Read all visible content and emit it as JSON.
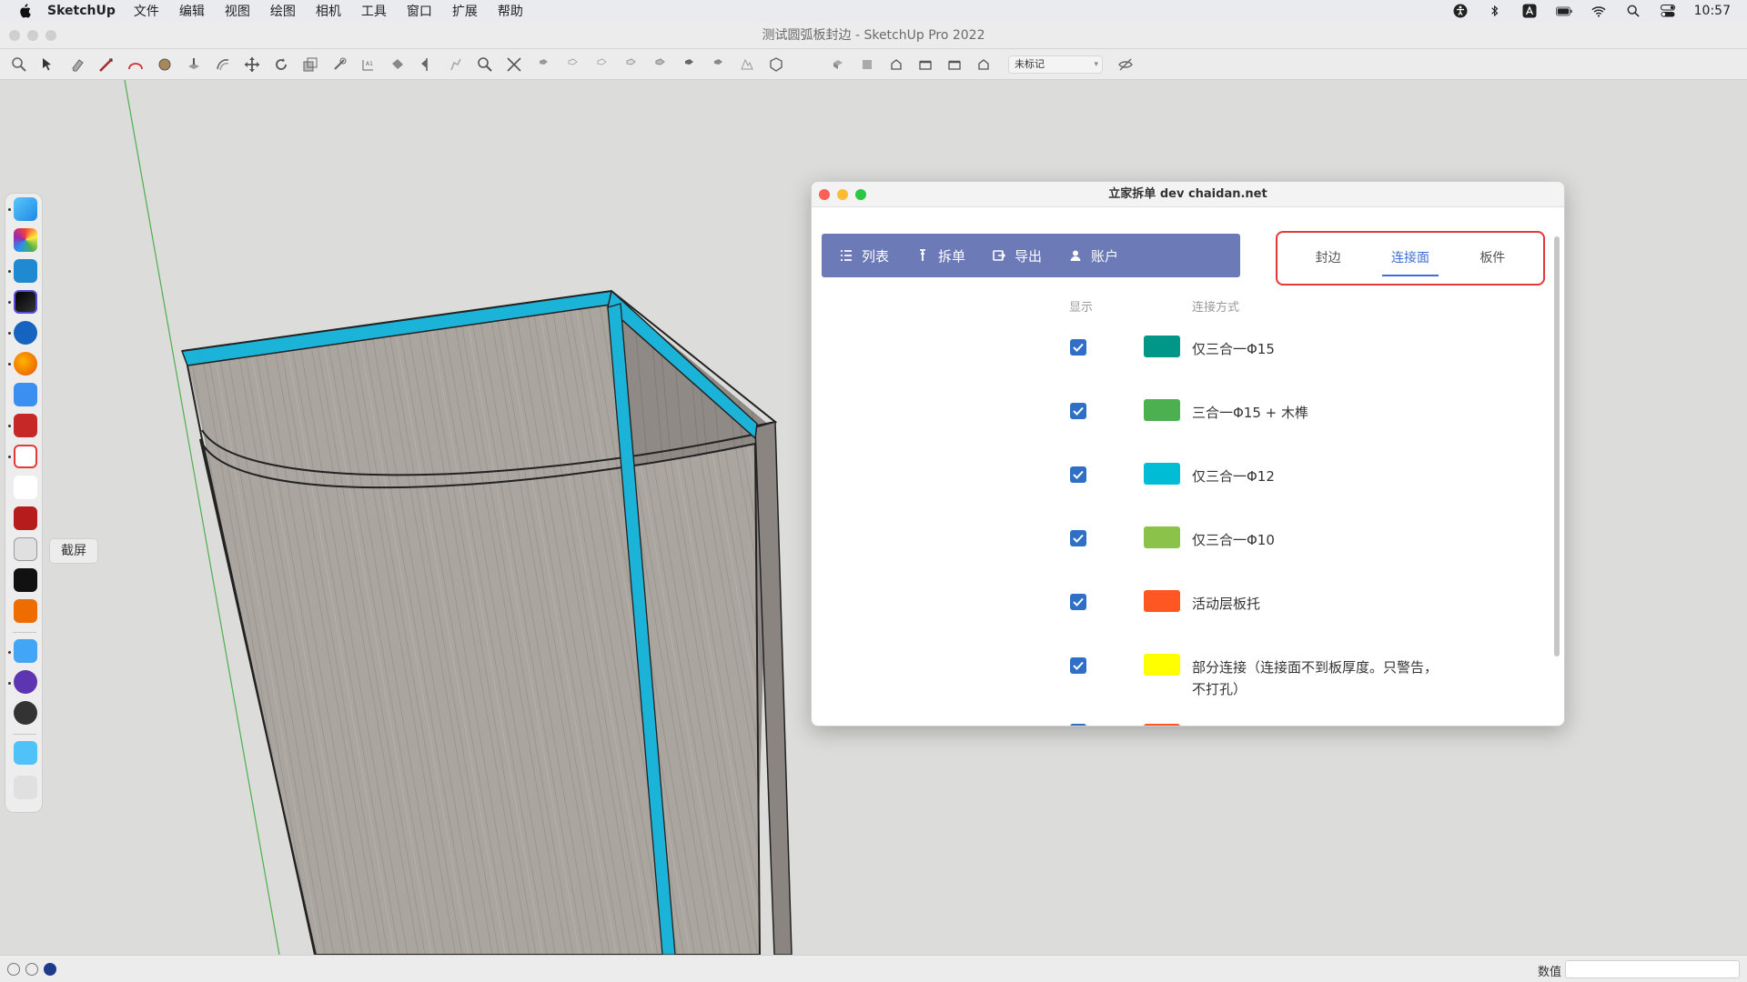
{
  "menubar": {
    "app_name": "SketchUp",
    "items": [
      "文件",
      "编辑",
      "视图",
      "绘图",
      "相机",
      "工具",
      "窗口",
      "扩展",
      "帮助"
    ],
    "clock": "10:57"
  },
  "window": {
    "title": "测试圆弧板封边 - SketchUp Pro 2022"
  },
  "toolbar": {
    "tag_select_value": "未标记"
  },
  "dock": {
    "tooltip": "截屏"
  },
  "plugin": {
    "title": "立家拆单 dev chaidan.net",
    "nav": [
      {
        "label": "列表",
        "icon": "list-icon"
      },
      {
        "label": "拆单",
        "icon": "pin-icon"
      },
      {
        "label": "导出",
        "icon": "export-icon"
      },
      {
        "label": "账户",
        "icon": "user-icon"
      }
    ],
    "tabs": [
      {
        "label": "封边",
        "active": false
      },
      {
        "label": "连接面",
        "active": true
      },
      {
        "label": "板件",
        "active": false
      }
    ],
    "columns": {
      "show": "显示",
      "method": "连接方式"
    },
    "rows": [
      {
        "checked": true,
        "color": "#009688",
        "label": "仅三合一Φ15"
      },
      {
        "checked": true,
        "color": "#4caf50",
        "label": "三合一Φ15 + 木榫"
      },
      {
        "checked": true,
        "color": "#00bcd4",
        "label": "仅三合一Φ12"
      },
      {
        "checked": true,
        "color": "#8bc34a",
        "label": "仅三合一Φ10"
      },
      {
        "checked": true,
        "color": "#ff5722",
        "label": "活动层板托"
      },
      {
        "checked": true,
        "color": "#ffff00",
        "label": "部分连接（连接面不到板厚度。只警告，不打孔）"
      }
    ]
  },
  "statusbar": {
    "value_label": "数值"
  }
}
